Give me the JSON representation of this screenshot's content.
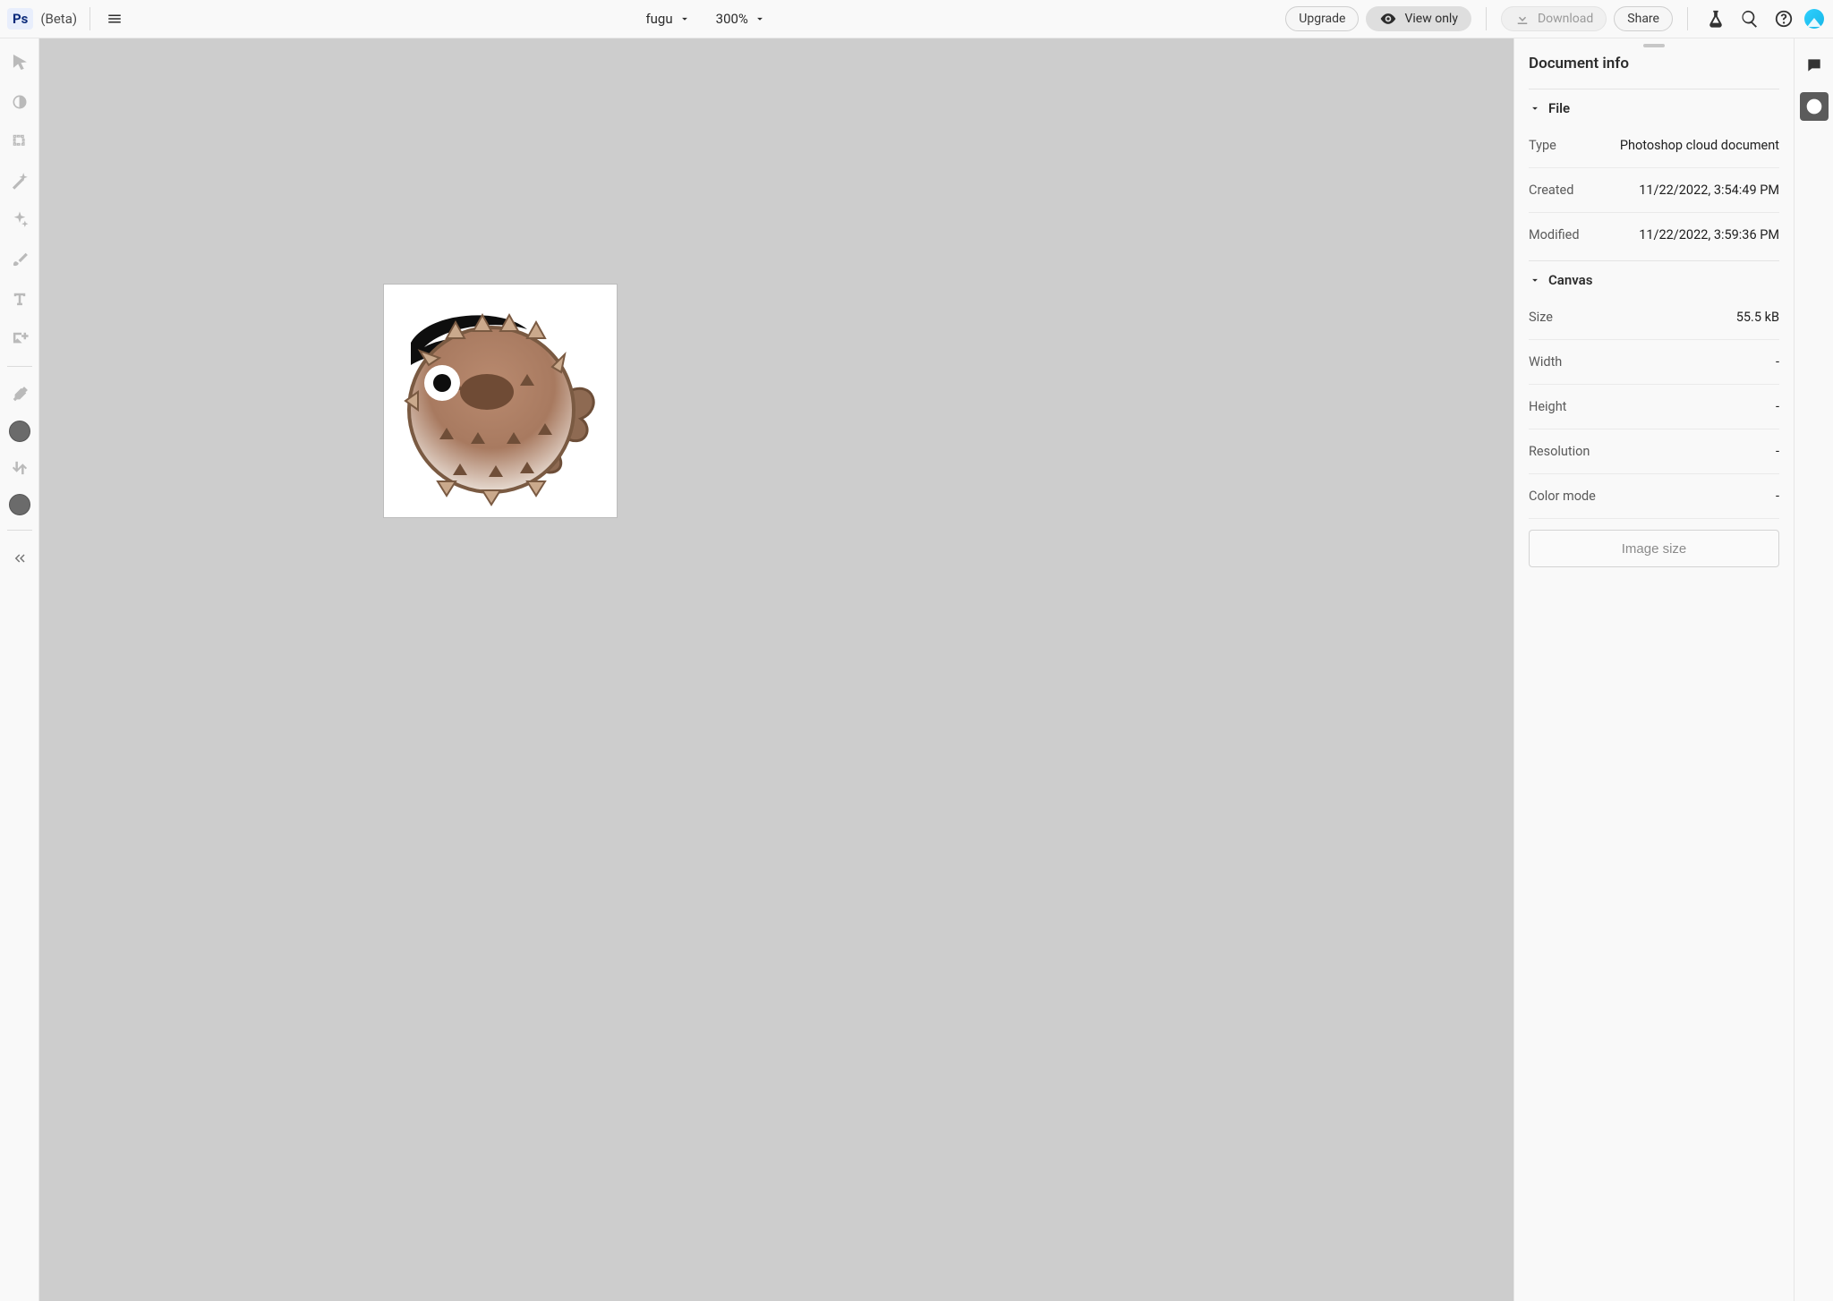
{
  "topbar": {
    "beta_label": "(Beta)",
    "doc_name": "fugu",
    "zoom": "300%",
    "upgrade": "Upgrade",
    "view_only": "View only",
    "download": "Download",
    "share": "Share"
  },
  "panel": {
    "title": "Document info",
    "file": {
      "heading": "File",
      "type_label": "Type",
      "type_value": "Photoshop cloud document",
      "created_label": "Created",
      "created_value": "11/22/2022, 3:54:49 PM",
      "modified_label": "Modified",
      "modified_value": "11/22/2022, 3:59:36 PM"
    },
    "canvas": {
      "heading": "Canvas",
      "size_label": "Size",
      "size_value": "55.5 kB",
      "width_label": "Width",
      "width_value": "-",
      "height_label": "Height",
      "height_value": "-",
      "resolution_label": "Resolution",
      "resolution_value": "-",
      "colormode_label": "Color mode",
      "colormode_value": "-",
      "image_size_btn": "Image size"
    }
  }
}
